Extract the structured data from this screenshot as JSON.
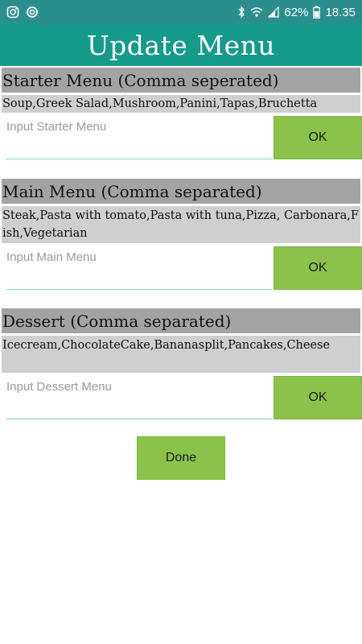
{
  "status_bar": {
    "battery": "62%",
    "time": "18.35",
    "left_icons": [
      "instagram-icon",
      "sync-icon"
    ],
    "right_icons": [
      "bluetooth-icon",
      "wifi-icon",
      "signal-icon",
      "battery-icon"
    ]
  },
  "app_bar": {
    "title": "Update Menu"
  },
  "sections": [
    {
      "header": "Starter Menu (Comma seperated)",
      "content": "Soup,Greek Salad,Mushroom,Panini,Tapas,Bruchetta",
      "placeholder": "Input Starter Menu",
      "button": "OK"
    },
    {
      "header": "Main Menu (Comma separated)",
      "content": "Steak,Pasta with tomato,Pasta with tuna,Pizza, Carbonara,Fish,Vegetarian",
      "placeholder": "Input Main Menu",
      "button": "OK"
    },
    {
      "header": "Dessert (Comma separated)",
      "content": "Icecream,ChocolateCake,Bananasplit,Pancakes,Cheese",
      "placeholder": "Input Dessert Menu",
      "button": "OK"
    }
  ],
  "done_button": "Done",
  "colors": {
    "status_bar": "#2a8f8c",
    "app_bar": "#169a8a",
    "section_header": "#a3a3a3",
    "section_content": "#cfcfcf",
    "button": "#8bc34a",
    "input_underline": "#7fd1c6"
  }
}
